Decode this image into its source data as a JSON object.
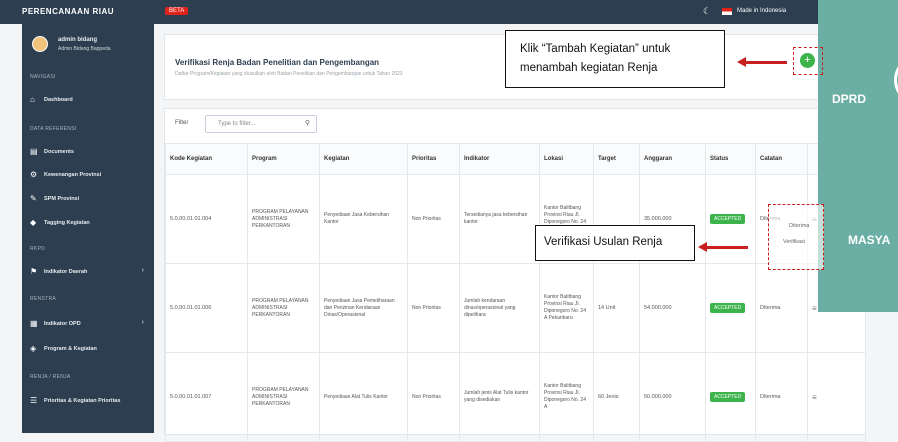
{
  "app": {
    "title": "PERENCANAAN RIAU",
    "badge": "BETA",
    "lang": "Made in Indonesia"
  },
  "user": {
    "name": "admin bidang",
    "role": "Admin Bidang Bappeda"
  },
  "sidebar": {
    "sections": [
      "NAVIGASI",
      "DATA REFERENSI",
      "RKPD",
      "RENSTRA",
      "RENJA / RENJA"
    ],
    "items": [
      {
        "label": "Dashboard",
        "icon": "home-icon"
      },
      {
        "label": "Documents",
        "icon": "document-icon"
      },
      {
        "label": "Kewenangan Provinsi",
        "icon": "gear-icon"
      },
      {
        "label": "SPM Provinsi",
        "icon": "edit-icon"
      },
      {
        "label": "Tagging Kegiatan",
        "icon": "tag-icon"
      },
      {
        "label": "Indikator Daerah",
        "icon": "flag-icon"
      },
      {
        "label": "Indikator OPD",
        "icon": "chart-icon"
      },
      {
        "label": "Program & Kegiatan",
        "icon": "stack-icon"
      },
      {
        "label": "Prioritas & Kegiatan Prioritas",
        "icon": "bars-icon"
      }
    ]
  },
  "page": {
    "title": "Verifikasi Renja Badan Penelitian dan Pengembangan",
    "subtitle": "Daftar Program/Kegiatan yang diusulkan oleh Badan Penelitian dan Pengembangan untuk Tahun 2023"
  },
  "filter": {
    "label": "Filter",
    "placeholder": "Type to filter..."
  },
  "table": {
    "columns": [
      "Kode Kegiatan",
      "Program",
      "Kegiatan",
      "Prioritas",
      "Indikator",
      "Lokasi",
      "Target",
      "Anggaran",
      "Status",
      "Catatan"
    ],
    "rows": [
      {
        "kode": "5.0.00.01.01.004",
        "program": "PROGRAM PELAYANAN ADMINISTRASI PERKANTORAN",
        "kegiatan": "Penyediaan Jasa Kebersihan Kantor",
        "prioritas": "Non Prioritas",
        "indikator": "Tersedianya jasa kebersihan kantor",
        "lokasi": "Kantor Balitbang Provinsi Riau Jl. Diponegoro No. 24 A Pekanbaru",
        "target": "",
        "anggaran": "35.000.000",
        "status": "ACCEPTED",
        "catatan": "Diterima"
      },
      {
        "kode": "5.0.00.01.01.006",
        "program": "PROGRAM PELAYANAN ADMINISTRASI PERKANTORAN",
        "kegiatan": "Penyediaan Jasa Pemeliharaan dan Perizinan Kendaraan Dinas/Operasional",
        "prioritas": "Non Prioritas",
        "indikator": "Jumlah kendaraan dinas/operasional yang dipelihara",
        "lokasi": "Kantor Balitbang Provinsi Riau Jl. Diponegoro No. 24 A Pekanbaru",
        "target": "14 Unit",
        "anggaran": "54.000.000",
        "status": "ACCEPTED",
        "catatan": "Diterima"
      },
      {
        "kode": "5.0.00.01.01.007",
        "program": "PROGRAM PELAYANAN ADMINISTRASI PERKANTORAN",
        "kegiatan": "Penyediaan Alat Tulis Kantor",
        "prioritas": "Non Prioritas",
        "indikator": "Jumlah jenis Alat Tulis kantor yang disediakan",
        "lokasi": "Kantor Balitbang Provinsi Riau Jl. Diponegoro No. 24 A",
        "target": "60 Jenis",
        "anggaran": "50.000.000",
        "status": "ACCEPTED",
        "catatan": "Diterima"
      }
    ]
  },
  "callouts": {
    "add": "Klik “Tambah Kegiatan” untuk menambah kegiatan Renja",
    "verify": "Verifikasi Usulan Renja"
  },
  "popup": {
    "row1": "Diterima",
    "row2": "Verifikasi"
  },
  "side_panel": {
    "title1": "DPRD",
    "title2": "MASYA"
  },
  "colors": {
    "sidebar": "#2c3e50",
    "accept": "#3cb44b",
    "annotation": "#c9201f",
    "panel": "#6aaea4"
  }
}
